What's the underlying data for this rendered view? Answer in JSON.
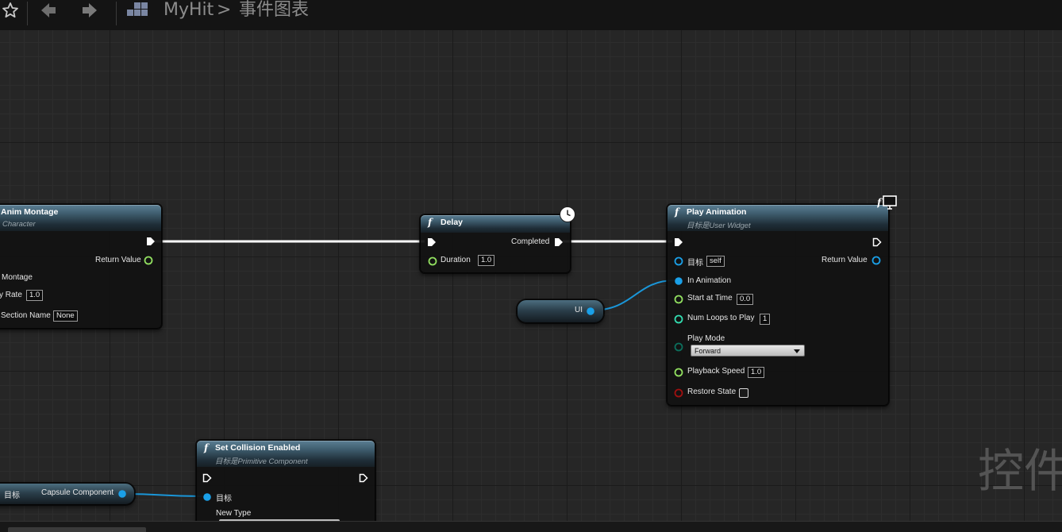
{
  "breadcrumb": {
    "root": "MyHit",
    "separator": ">",
    "current": "事件图表"
  },
  "nodes": {
    "anim_montage": {
      "title": "Anim Montage",
      "subtitle": "Character",
      "return_value": "Return Value",
      "montage_label": "Montage",
      "rate_label": "y Rate",
      "rate_value": "1.0",
      "section_label": "Section Name",
      "section_value": "None"
    },
    "delay": {
      "title": "Delay",
      "completed": "Completed",
      "duration_label": "Duration",
      "duration_value": "1.0"
    },
    "play_animation": {
      "title": "Play Animation",
      "subtitle": "目标是User Widget",
      "target_label": "目标",
      "target_value": "self",
      "return_value": "Return Value",
      "in_animation": "In Animation",
      "start_label": "Start at Time",
      "start_value": "0.0",
      "loops_label": "Num Loops to Play",
      "loops_value": "1",
      "mode_label": "Play Mode",
      "mode_value": "Forward",
      "speed_label": "Playback Speed",
      "speed_value": "1.0",
      "restore_label": "Restore State"
    },
    "set_collision": {
      "title": "Set Collision Enabled",
      "subtitle": "目标是Primitive Component",
      "target_label": "目标",
      "new_type_label": "New Type"
    },
    "ui_var": {
      "label": "UI"
    },
    "capsule_var": {
      "prefix": "目标",
      "label": "Capsule Component"
    }
  },
  "watermark": "控件",
  "colors": {
    "exec": "#ffffff",
    "object_pin": "#1aa0e8",
    "float_pin": "#92e060",
    "int_pin": "#33dcb0",
    "byte_pin": "#0c6e5c",
    "bool_pin": "#a01010"
  }
}
